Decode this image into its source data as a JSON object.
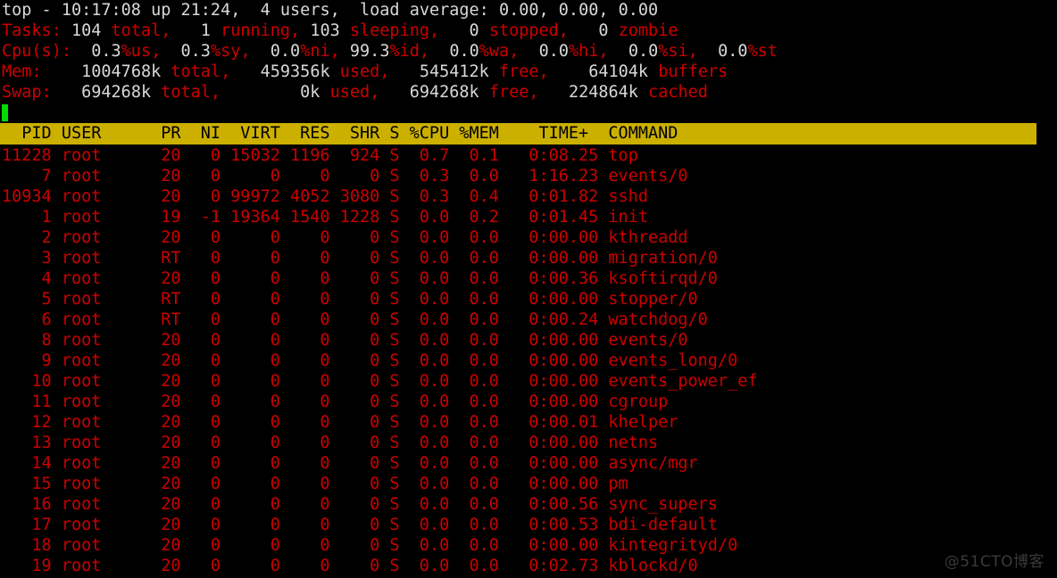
{
  "terminal": {
    "program": "top",
    "colors": {
      "background": "#000000",
      "text_red": "#cc0000",
      "text_white": "#d8d8d8",
      "header_bar_bg": "#cbb000",
      "header_bar_fg": "#000000",
      "cursor_green": "#00dd00",
      "watermark": "#3a3a3a"
    }
  },
  "summary": {
    "uptime_line": "top - 10:17:08 up 21:24,  4 users,  load average: 0.00, 0.00, 0.00",
    "uptime": {
      "label": "top -",
      "time": "10:17:08",
      "up_label": "up",
      "up_value": "21:24,",
      "users_count": "4",
      "users_label": "users,",
      "load_label": "load average:",
      "load_1min": "0.00,",
      "load_5min": "0.00,",
      "load_15min": "0.00"
    },
    "tasks": {
      "label": "Tasks:",
      "total_value": "104",
      "total_label": "total,",
      "running_value": "1",
      "running_label": "running,",
      "sleeping_value": "103",
      "sleeping_label": "sleeping,",
      "stopped_value": "0",
      "stopped_label": "stopped,",
      "zombie_value": "0",
      "zombie_label": "zombie"
    },
    "cpu": {
      "label": "Cpu(s):",
      "us_value": "0.3",
      "us_label": "%us,",
      "sy_value": "0.3",
      "sy_label": "%sy,",
      "ni_value": "0.0",
      "ni_label": "%ni,",
      "id_value": "99.3",
      "id_label": "%id,",
      "wa_value": "0.0",
      "wa_label": "%wa,",
      "hi_value": "0.0",
      "hi_label": "%hi,",
      "si_value": "0.0",
      "si_label": "%si,",
      "st_value": "0.0",
      "st_label": "%st"
    },
    "mem": {
      "label": "Mem:",
      "total_value": "1004768k",
      "total_label": "total,",
      "used_value": "459356k",
      "used_label": "used,",
      "free_value": "545412k",
      "free_label": "free,",
      "buffers_value": "64104k",
      "buffers_label": "buffers"
    },
    "swap": {
      "label": "Swap:",
      "total_value": "694268k",
      "total_label": "total,",
      "used_value": "0k",
      "used_label": "used,",
      "free_value": "694268k",
      "free_label": "free,",
      "cached_value": "224864k",
      "cached_label": "cached"
    }
  },
  "table": {
    "header_line": "  PID USER      PR  NI  VIRT  RES  SHR S %CPU %MEM    TIME+  COMMAND",
    "columns": [
      "PID",
      "USER",
      "PR",
      "NI",
      "VIRT",
      "RES",
      "SHR",
      "S",
      "%CPU",
      "%MEM",
      "TIME+",
      "COMMAND"
    ],
    "rows": [
      {
        "line": "11228 root      20   0 15032 1196  924 S  0.7  0.1   0:08.25 top",
        "pid": "11228",
        "user": "root",
        "pr": "20",
        "ni": "0",
        "virt": "15032",
        "res": "1196",
        "shr": "924",
        "s": "S",
        "cpu": "0.7",
        "mem": "0.1",
        "time": "0:08.25",
        "command": "top"
      },
      {
        "line": "    7 root      20   0     0    0    0 S  0.3  0.0   1:16.23 events/0",
        "pid": "7",
        "user": "root",
        "pr": "20",
        "ni": "0",
        "virt": "0",
        "res": "0",
        "shr": "0",
        "s": "S",
        "cpu": "0.3",
        "mem": "0.0",
        "time": "1:16.23",
        "command": "events/0"
      },
      {
        "line": "10934 root      20   0 99972 4052 3080 S  0.3  0.4   0:01.82 sshd",
        "pid": "10934",
        "user": "root",
        "pr": "20",
        "ni": "0",
        "virt": "99972",
        "res": "4052",
        "shr": "3080",
        "s": "S",
        "cpu": "0.3",
        "mem": "0.4",
        "time": "0:01.82",
        "command": "sshd"
      },
      {
        "line": "    1 root      19  -1 19364 1540 1228 S  0.0  0.2   0:01.45 init",
        "pid": "1",
        "user": "root",
        "pr": "19",
        "ni": "-1",
        "virt": "19364",
        "res": "1540",
        "shr": "1228",
        "s": "S",
        "cpu": "0.0",
        "mem": "0.2",
        "time": "0:01.45",
        "command": "init"
      },
      {
        "line": "    2 root      20   0     0    0    0 S  0.0  0.0   0:00.00 kthreadd",
        "pid": "2",
        "user": "root",
        "pr": "20",
        "ni": "0",
        "virt": "0",
        "res": "0",
        "shr": "0",
        "s": "S",
        "cpu": "0.0",
        "mem": "0.0",
        "time": "0:00.00",
        "command": "kthreadd"
      },
      {
        "line": "    3 root      RT   0     0    0    0 S  0.0  0.0   0:00.00 migration/0",
        "pid": "3",
        "user": "root",
        "pr": "RT",
        "ni": "0",
        "virt": "0",
        "res": "0",
        "shr": "0",
        "s": "S",
        "cpu": "0.0",
        "mem": "0.0",
        "time": "0:00.00",
        "command": "migration/0"
      },
      {
        "line": "    4 root      20   0     0    0    0 S  0.0  0.0   0:00.36 ksoftirqd/0",
        "pid": "4",
        "user": "root",
        "pr": "20",
        "ni": "0",
        "virt": "0",
        "res": "0",
        "shr": "0",
        "s": "S",
        "cpu": "0.0",
        "mem": "0.0",
        "time": "0:00.36",
        "command": "ksoftirqd/0"
      },
      {
        "line": "    5 root      RT   0     0    0    0 S  0.0  0.0   0:00.00 stopper/0",
        "pid": "5",
        "user": "root",
        "pr": "RT",
        "ni": "0",
        "virt": "0",
        "res": "0",
        "shr": "0",
        "s": "S",
        "cpu": "0.0",
        "mem": "0.0",
        "time": "0:00.00",
        "command": "stopper/0"
      },
      {
        "line": "    6 root      RT   0     0    0    0 S  0.0  0.0   0:00.24 watchdog/0",
        "pid": "6",
        "user": "root",
        "pr": "RT",
        "ni": "0",
        "virt": "0",
        "res": "0",
        "shr": "0",
        "s": "S",
        "cpu": "0.0",
        "mem": "0.0",
        "time": "0:00.24",
        "command": "watchdog/0"
      },
      {
        "line": "    8 root      20   0     0    0    0 S  0.0  0.0   0:00.00 events/0",
        "pid": "8",
        "user": "root",
        "pr": "20",
        "ni": "0",
        "virt": "0",
        "res": "0",
        "shr": "0",
        "s": "S",
        "cpu": "0.0",
        "mem": "0.0",
        "time": "0:00.00",
        "command": "events/0"
      },
      {
        "line": "    9 root      20   0     0    0    0 S  0.0  0.0   0:00.00 events_long/0",
        "pid": "9",
        "user": "root",
        "pr": "20",
        "ni": "0",
        "virt": "0",
        "res": "0",
        "shr": "0",
        "s": "S",
        "cpu": "0.0",
        "mem": "0.0",
        "time": "0:00.00",
        "command": "events_long/0"
      },
      {
        "line": "   10 root      20   0     0    0    0 S  0.0  0.0   0:00.00 events_power_ef",
        "pid": "10",
        "user": "root",
        "pr": "20",
        "ni": "0",
        "virt": "0",
        "res": "0",
        "shr": "0",
        "s": "S",
        "cpu": "0.0",
        "mem": "0.0",
        "time": "0:00.00",
        "command": "events_power_ef"
      },
      {
        "line": "   11 root      20   0     0    0    0 S  0.0  0.0   0:00.00 cgroup",
        "pid": "11",
        "user": "root",
        "pr": "20",
        "ni": "0",
        "virt": "0",
        "res": "0",
        "shr": "0",
        "s": "S",
        "cpu": "0.0",
        "mem": "0.0",
        "time": "0:00.00",
        "command": "cgroup"
      },
      {
        "line": "   12 root      20   0     0    0    0 S  0.0  0.0   0:00.01 khelper",
        "pid": "12",
        "user": "root",
        "pr": "20",
        "ni": "0",
        "virt": "0",
        "res": "0",
        "shr": "0",
        "s": "S",
        "cpu": "0.0",
        "mem": "0.0",
        "time": "0:00.01",
        "command": "khelper"
      },
      {
        "line": "   13 root      20   0     0    0    0 S  0.0  0.0   0:00.00 netns",
        "pid": "13",
        "user": "root",
        "pr": "20",
        "ni": "0",
        "virt": "0",
        "res": "0",
        "shr": "0",
        "s": "S",
        "cpu": "0.0",
        "mem": "0.0",
        "time": "0:00.00",
        "command": "netns"
      },
      {
        "line": "   14 root      20   0     0    0    0 S  0.0  0.0   0:00.00 async/mgr",
        "pid": "14",
        "user": "root",
        "pr": "20",
        "ni": "0",
        "virt": "0",
        "res": "0",
        "shr": "0",
        "s": "S",
        "cpu": "0.0",
        "mem": "0.0",
        "time": "0:00.00",
        "command": "async/mgr"
      },
      {
        "line": "   15 root      20   0     0    0    0 S  0.0  0.0   0:00.00 pm",
        "pid": "15",
        "user": "root",
        "pr": "20",
        "ni": "0",
        "virt": "0",
        "res": "0",
        "shr": "0",
        "s": "S",
        "cpu": "0.0",
        "mem": "0.0",
        "time": "0:00.00",
        "command": "pm"
      },
      {
        "line": "   16 root      20   0     0    0    0 S  0.0  0.0   0:00.56 sync_supers",
        "pid": "16",
        "user": "root",
        "pr": "20",
        "ni": "0",
        "virt": "0",
        "res": "0",
        "shr": "0",
        "s": "S",
        "cpu": "0.0",
        "mem": "0.0",
        "time": "0:00.56",
        "command": "sync_supers"
      },
      {
        "line": "   17 root      20   0     0    0    0 S  0.0  0.0   0:00.53 bdi-default",
        "pid": "17",
        "user": "root",
        "pr": "20",
        "ni": "0",
        "virt": "0",
        "res": "0",
        "shr": "0",
        "s": "S",
        "cpu": "0.0",
        "mem": "0.0",
        "time": "0:00.53",
        "command": "bdi-default"
      },
      {
        "line": "   18 root      20   0     0    0    0 S  0.0  0.0   0:00.00 kintegrityd/0",
        "pid": "18",
        "user": "root",
        "pr": "20",
        "ni": "0",
        "virt": "0",
        "res": "0",
        "shr": "0",
        "s": "S",
        "cpu": "0.0",
        "mem": "0.0",
        "time": "0:00.00",
        "command": "kintegrityd/0"
      },
      {
        "line": "   19 root      20   0     0    0    0 S  0.0  0.0   0:02.73 kblockd/0",
        "pid": "19",
        "user": "root",
        "pr": "20",
        "ni": "0",
        "virt": "0",
        "res": "0",
        "shr": "0",
        "s": "S",
        "cpu": "0.0",
        "mem": "0.0",
        "time": "0:02.73",
        "command": "kblockd/0"
      }
    ]
  },
  "watermark": {
    "text": "@51CTO博客"
  }
}
